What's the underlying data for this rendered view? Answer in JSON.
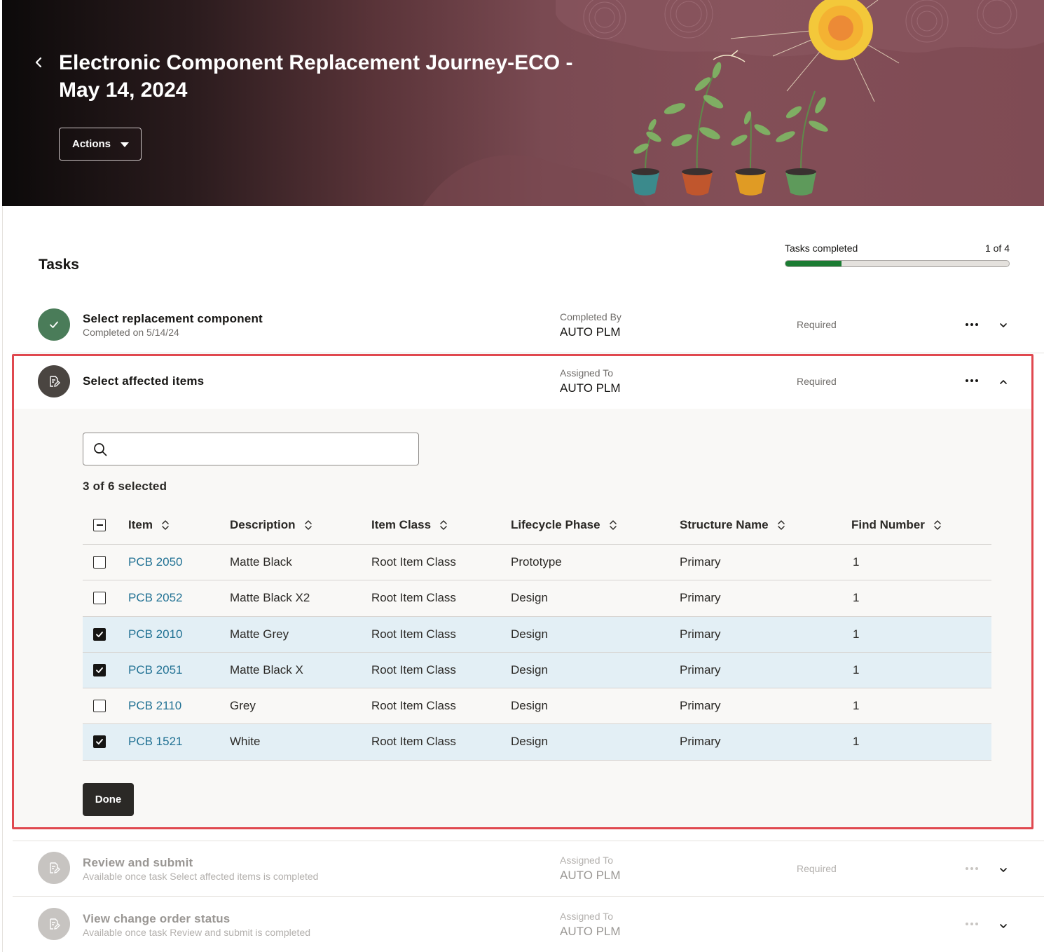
{
  "header": {
    "title": "Electronic Component Replacement Journey-ECO - May 14, 2024",
    "actions_label": "Actions"
  },
  "tasks_section": {
    "title": "Tasks",
    "progress": {
      "label": "Tasks completed",
      "count_text": "1 of 4",
      "fraction": 0.25
    }
  },
  "tasks": [
    {
      "name": "Select replacement component",
      "subtitle": "Completed on 5/14/24",
      "assign_label": "Completed By",
      "assignee": "AUTO PLM",
      "requirement": "Required",
      "status": "completed"
    },
    {
      "name": "Select affected items",
      "subtitle": "",
      "assign_label": "Assigned To",
      "assignee": "AUTO PLM",
      "requirement": "Required",
      "status": "active"
    },
    {
      "name": "Review and submit",
      "subtitle": "Available once task Select affected items is completed",
      "assign_label": "Assigned To",
      "assignee": "AUTO PLM",
      "requirement": "Required",
      "status": "locked"
    },
    {
      "name": "View change order status",
      "subtitle": "Available once task Review and submit is completed",
      "assign_label": "Assigned To",
      "assignee": "AUTO PLM",
      "requirement": "",
      "status": "locked"
    }
  ],
  "affected_items": {
    "search": {
      "value": "",
      "placeholder": ""
    },
    "selection_text": "3 of 6 selected",
    "columns": [
      "Item",
      "Description",
      "Item Class",
      "Lifecycle Phase",
      "Structure Name",
      "Find Number"
    ],
    "rows": [
      {
        "checked": false,
        "item": "PCB 2050",
        "description": "Matte Black",
        "item_class": "Root Item Class",
        "lifecycle": "Prototype",
        "structure": "Primary",
        "find_number": "1"
      },
      {
        "checked": false,
        "item": "PCB 2052",
        "description": "Matte Black X2",
        "item_class": "Root Item Class",
        "lifecycle": "Design",
        "structure": "Primary",
        "find_number": "1"
      },
      {
        "checked": true,
        "item": "PCB 2010",
        "description": "Matte Grey",
        "item_class": "Root Item Class",
        "lifecycle": "Design",
        "structure": "Primary",
        "find_number": "1"
      },
      {
        "checked": true,
        "item": "PCB 2051",
        "description": "Matte Black X",
        "item_class": "Root Item Class",
        "lifecycle": "Design",
        "structure": "Primary",
        "find_number": "1"
      },
      {
        "checked": false,
        "item": "PCB 2110",
        "description": "Grey",
        "item_class": "Root Item Class",
        "lifecycle": "Design",
        "structure": "Primary",
        "find_number": "1"
      },
      {
        "checked": true,
        "item": "PCB 1521",
        "description": "White",
        "item_class": "Root Item Class",
        "lifecycle": "Design",
        "structure": "Primary",
        "find_number": "1"
      }
    ],
    "done_label": "Done"
  },
  "colors": {
    "accent_green": "#1b7c33",
    "completed_icon": "#4a7c59",
    "active_icon": "#4a4541",
    "locked_icon": "#c7c4c1",
    "link": "#227294",
    "highlight_border": "#e0484f",
    "selected_row": "#e3eff5"
  },
  "icons": {
    "back": "chevron-left-icon",
    "completed": "checkmark-icon",
    "task": "document-edit-icon",
    "search": "search-icon",
    "sort": "sort-icon",
    "more": "more-options-icon"
  }
}
